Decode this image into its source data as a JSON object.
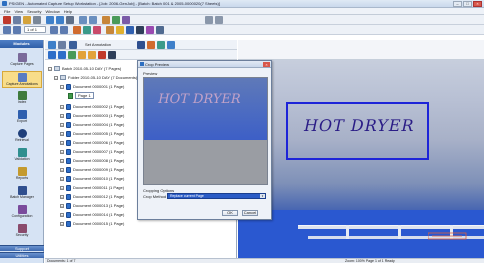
{
  "app": {
    "title": "PSIGEN - Automated Capture Setup Workstation - [Job: 2006-GenJob] - [Batch: Batch 001 & 2005-0000020(7 Sheets)]"
  },
  "menu": [
    "File",
    "View",
    "Security",
    "Window",
    "Help"
  ],
  "toolbar2": {
    "page_value": "1 of 1"
  },
  "sidebar": {
    "header": "Modules",
    "items": [
      {
        "label": "Capture Pages",
        "icon": "scanner-icon",
        "color": "#7a6a9a"
      },
      {
        "label": "Capture Annotations",
        "icon": "capture-icon",
        "color": "#5a7cc2"
      },
      {
        "label": "Index",
        "icon": "index-icon",
        "color": "#3e7a3c"
      },
      {
        "label": "Export",
        "icon": "export-icon",
        "color": "#2e5fae"
      },
      {
        "label": "Retrieval",
        "icon": "magnifier-icon",
        "color": "#1f3f7a"
      },
      {
        "label": "Validation",
        "icon": "calendar-icon",
        "color": "#2f8f8f"
      },
      {
        "label": "Reports",
        "icon": "report-icon",
        "color": "#c49a2e"
      },
      {
        "label": "Batch Manager",
        "icon": "batch-manager-icon",
        "color": "#2f4f8f"
      },
      {
        "label": "Configuration",
        "icon": "configuration-icon",
        "color": "#7a4b9c"
      },
      {
        "label": "Security",
        "icon": "security-icon",
        "color": "#8a4b6c"
      }
    ],
    "footer1": "Support",
    "footer2": "Utilities"
  },
  "tree_panel": {
    "toolbar_label": "Set Annotation",
    "root": "Batch 2010-05-10 DAY (7 Pages)",
    "folder": "Folder 2010-05-10 DAY (7 Documents)",
    "documents": [
      {
        "label": "Document 0000001 (1 Page)",
        "expanded": true,
        "page": "Page 1"
      },
      {
        "label": "Document 0000002 (1 Page)"
      },
      {
        "label": "Document 0000003 (1 Page)"
      },
      {
        "label": "Document 0000004 (1 Page)"
      },
      {
        "label": "Document 0000005 (1 Page)"
      },
      {
        "label": "Document 0000006 (1 Page)"
      },
      {
        "label": "Document 0000007 (1 Page)"
      },
      {
        "label": "Document 0000008 (1 Page)"
      },
      {
        "label": "Document 0000009 (1 Page)"
      },
      {
        "label": "Document 0000010 (1 Page)"
      },
      {
        "label": "Document 0000011 (1 Page)"
      },
      {
        "label": "Document 0000012 (1 Page)"
      },
      {
        "label": "Document 0000013 (1 Page)"
      },
      {
        "label": "Document 0000014 (1 Page)"
      },
      {
        "label": "Document 0000015 (1 Page)"
      }
    ]
  },
  "dialog": {
    "title": "Crop Preview",
    "preview_label": "Preview",
    "options_group": "Cropping Options",
    "option_name": "Crop Method",
    "option_value": "Replace current Page",
    "ok": "OK",
    "cancel": "Cancel"
  },
  "viewer": {
    "graffiti_text": "HOT DRYER"
  },
  "status": {
    "left": "Documents: 1 of 7",
    "right": "Zoom: 100%  Page 1 of 1  Ready"
  }
}
